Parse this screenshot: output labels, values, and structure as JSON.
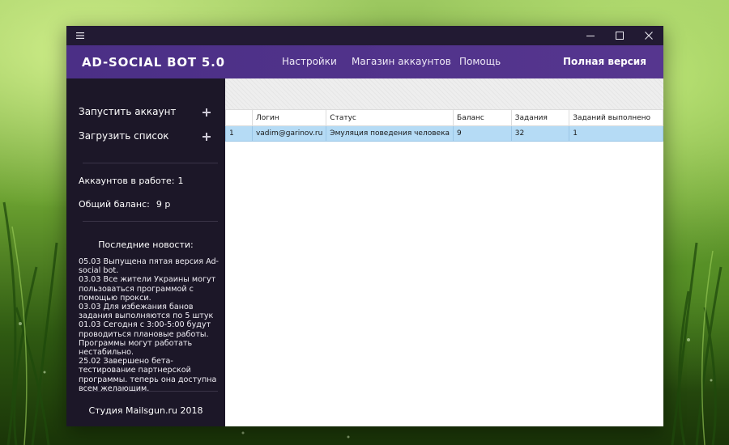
{
  "window": {
    "title_bar": {
      "menu_icon": "hamburger-icon",
      "controls": [
        "minimize-icon",
        "maximize-icon",
        "close-icon"
      ]
    },
    "header": {
      "app_title": "AD-SOCIAL BOT 5.0",
      "nav": [
        "Настройки",
        "Магазин аккаунтов",
        "Помощь"
      ],
      "full_version": "Полная версия",
      "color": "#4b2f86"
    }
  },
  "sidebar": {
    "actions": [
      {
        "label": "Запустить аккаунт",
        "icon": "plus-icon"
      },
      {
        "label": "Загрузить список",
        "icon": "plus-icon"
      }
    ],
    "stats": {
      "accounts_label": "Аккаунтов в работе:",
      "accounts_value": "1",
      "balance_label": "Общий баланс:",
      "balance_value": "9 р"
    },
    "news_title": "Последние новости:",
    "news": [
      "05.03 Выпущена пятая версия Ad-social bot.",
      "03.03 Все жители Украины могут пользоваться программой с помощью прокси.",
      "03.03 Для избежания банов задания выполняются по 5 штук",
      "01.03 Сегодня с 3:00-5:00 будут проводиться плановые работы. Программы могут работать нестабильно.",
      "25.02 Завершено бета-тестирование партнерской программы. теперь она доступна всем желающим."
    ],
    "footer": "Студия Mailsgun.ru 2018",
    "background": "#1c1728"
  },
  "table": {
    "columns": [
      "",
      "Логин",
      "Статус",
      "Баланс",
      "Задания",
      "Заданий выполнено"
    ],
    "rows": [
      [
        "1",
        "vadim@garinov.ru",
        "Эмуляция поведения человека",
        "9",
        "32",
        "1"
      ]
    ],
    "selected_row_color": "#b5dbf5"
  }
}
